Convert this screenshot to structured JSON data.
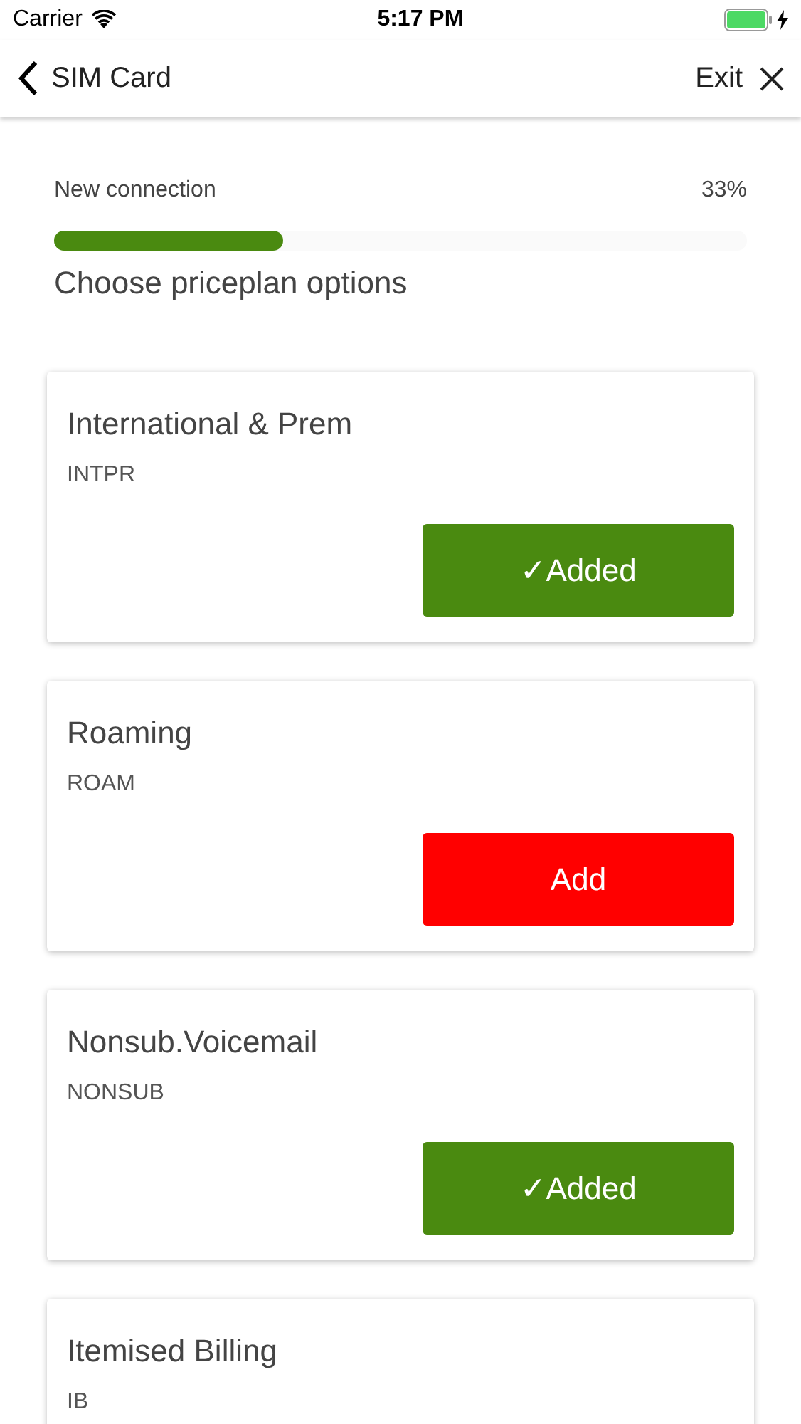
{
  "status_bar": {
    "carrier": "Carrier",
    "time": "5:17 PM"
  },
  "nav": {
    "back_label": "SIM Card",
    "exit_label": "Exit"
  },
  "progress": {
    "title": "New connection",
    "percent": "33%",
    "level": 0.33,
    "step": "Choose priceplan options"
  },
  "options": [
    {
      "name": "International & Prem",
      "code": "INTPR",
      "button": "✓Added",
      "added": true
    },
    {
      "name": "Roaming",
      "code": "ROAM",
      "button": "Add",
      "added": false
    },
    {
      "name": "Nonsub.Voicemail",
      "code": "NONSUB",
      "button": "✓Added",
      "added": true
    },
    {
      "name": "Itemised Billing",
      "code": "IB"
    }
  ]
}
